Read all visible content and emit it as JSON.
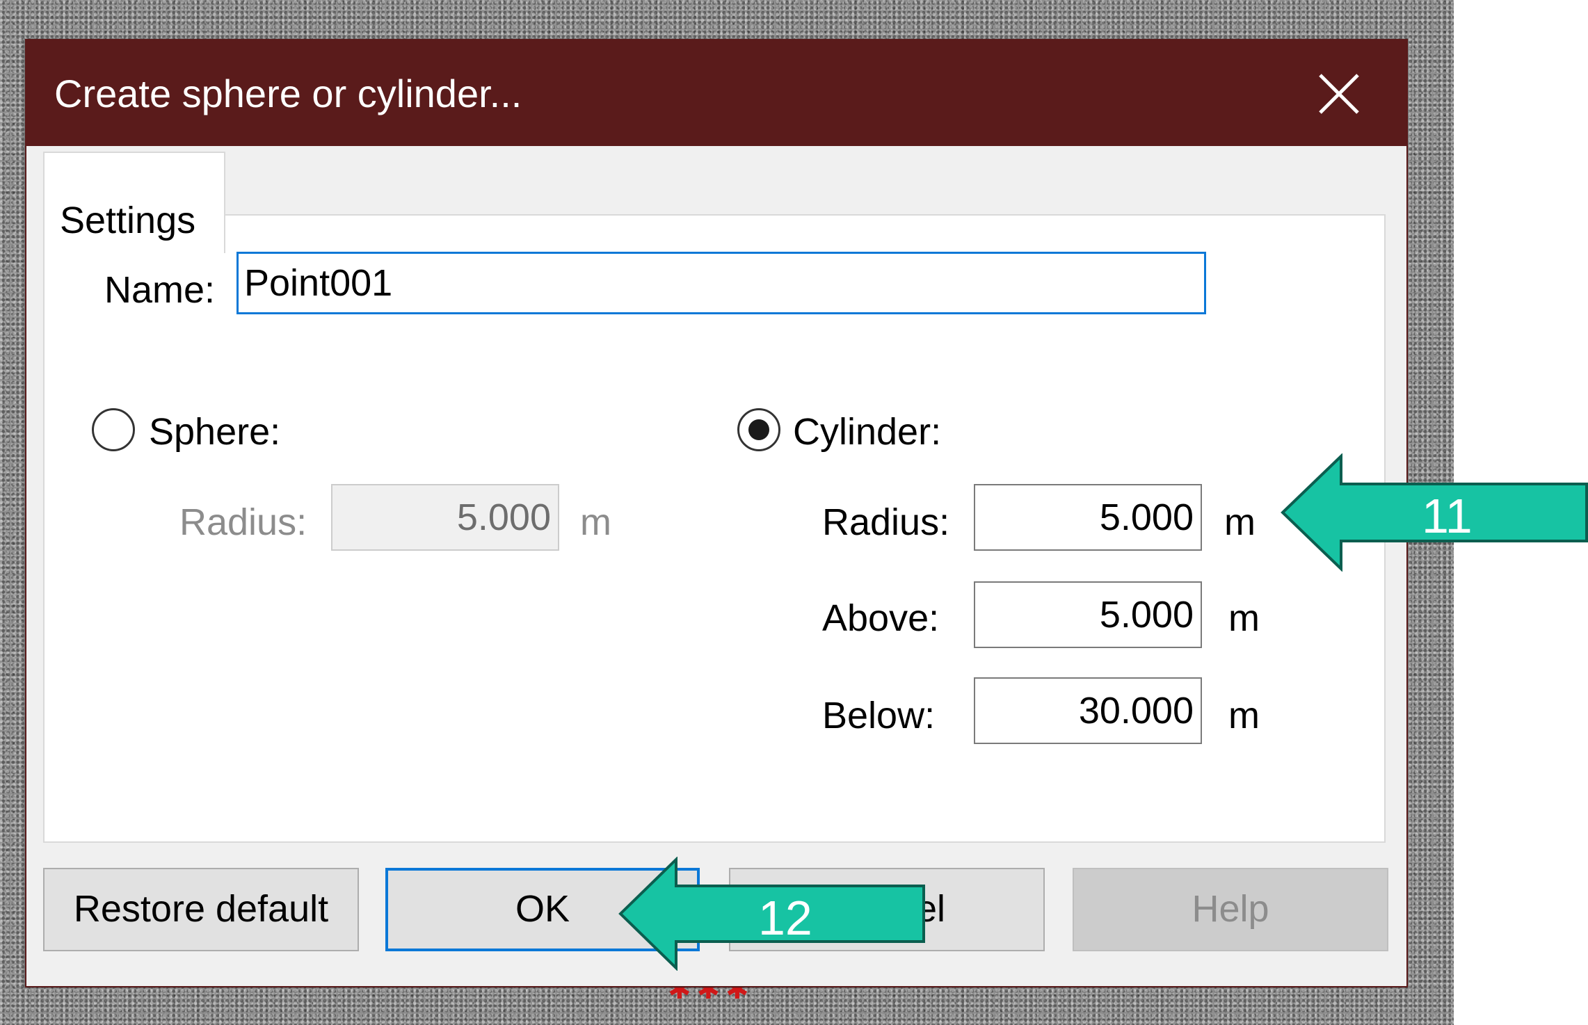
{
  "window": {
    "title": "Create sphere or cylinder...",
    "close_icon": "close-icon"
  },
  "tabs": [
    {
      "label": "Settings",
      "selected": true
    }
  ],
  "form": {
    "name_label": "Name:",
    "name_value": "Point001",
    "sphere": {
      "label": "Sphere:",
      "selected": false,
      "radius_label": "Radius:",
      "radius_value": "5.000",
      "radius_unit": "m",
      "enabled": false
    },
    "cylinder": {
      "label": "Cylinder:",
      "selected": true,
      "radius_label": "Radius:",
      "radius_value": "5.000",
      "radius_unit": "m",
      "above_label": "Above:",
      "above_value": "5.000",
      "above_unit": "m",
      "below_label": "Below:",
      "below_value": "30.000",
      "below_unit": "m"
    }
  },
  "buttons": {
    "restore_default": "Restore default",
    "ok": "OK",
    "cancel": "Cancel",
    "help": "Help"
  },
  "annotations": {
    "step_11": "11",
    "step_12": "12",
    "arrow_color": "#17c3a3",
    "arrow_outline": "#0b5e4f"
  },
  "colors": {
    "titlebar": "#5a1b1b",
    "focus_border": "#0b78d7"
  }
}
